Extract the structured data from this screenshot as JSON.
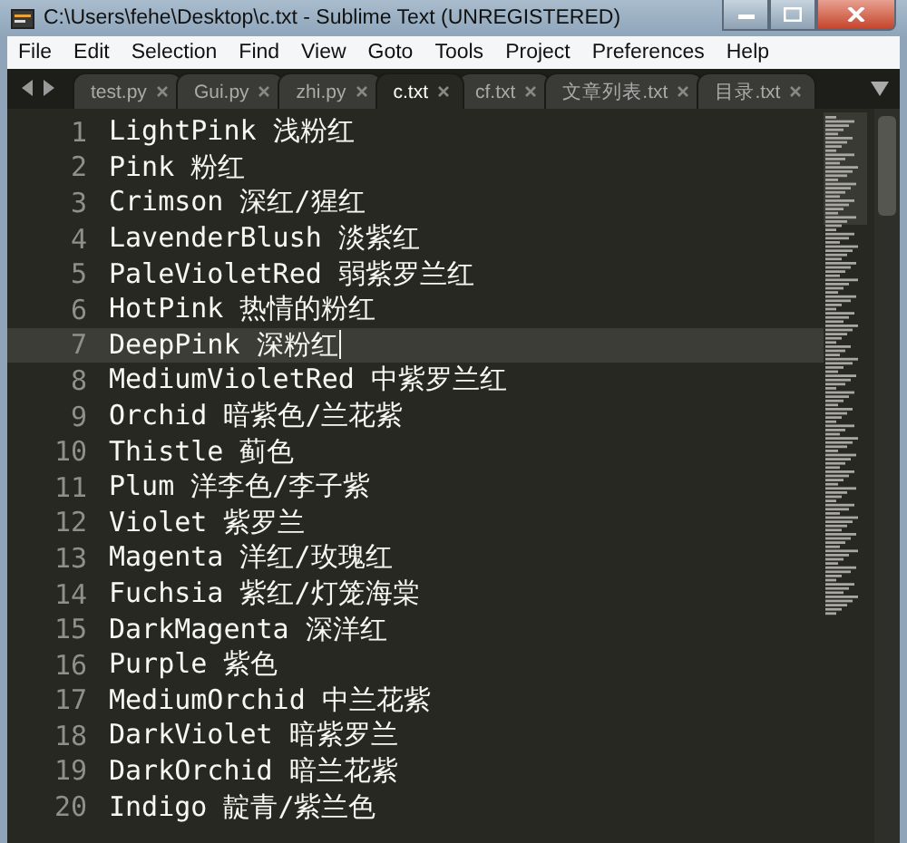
{
  "window": {
    "title": "C:\\Users\\fehe\\Desktop\\c.txt - Sublime Text (UNREGISTERED)"
  },
  "menu": [
    "File",
    "Edit",
    "Selection",
    "Find",
    "View",
    "Goto",
    "Tools",
    "Project",
    "Preferences",
    "Help"
  ],
  "tabs": [
    {
      "label": "test.py",
      "selected": false
    },
    {
      "label": "Gui.py",
      "selected": false
    },
    {
      "label": "zhi.py",
      "selected": false
    },
    {
      "label": "c.txt",
      "selected": true
    },
    {
      "label": "cf.txt",
      "selected": false
    },
    {
      "label": "文章列表.txt",
      "selected": false
    },
    {
      "label": "目录.txt",
      "selected": false
    }
  ],
  "lines": [
    {
      "number": "1",
      "text": "LightPink 浅粉红",
      "current": false
    },
    {
      "number": "2",
      "text": "Pink 粉红",
      "current": false
    },
    {
      "number": "3",
      "text": "Crimson 深红/猩红",
      "current": false
    },
    {
      "number": "4",
      "text": "LavenderBlush 淡紫红",
      "current": false
    },
    {
      "number": "5",
      "text": "PaleVioletRed 弱紫罗兰红",
      "current": false
    },
    {
      "number": "6",
      "text": "HotPink 热情的粉红",
      "current": false
    },
    {
      "number": "7",
      "text": "DeepPink 深粉红",
      "current": true
    },
    {
      "number": "8",
      "text": "MediumVioletRed 中紫罗兰红",
      "current": false
    },
    {
      "number": "9",
      "text": "Orchid 暗紫色/兰花紫",
      "current": false
    },
    {
      "number": "10",
      "text": "Thistle 蓟色",
      "current": false
    },
    {
      "number": "11",
      "text": "Plum 洋李色/李子紫",
      "current": false
    },
    {
      "number": "12",
      "text": "Violet 紫罗兰",
      "current": false
    },
    {
      "number": "13",
      "text": "Magenta 洋红/玫瑰红",
      "current": false
    },
    {
      "number": "14",
      "text": "Fuchsia 紫红/灯笼海棠",
      "current": false
    },
    {
      "number": "15",
      "text": "DarkMagenta 深洋红",
      "current": false
    },
    {
      "number": "16",
      "text": "Purple 紫色",
      "current": false
    },
    {
      "number": "17",
      "text": "MediumOrchid 中兰花紫",
      "current": false
    },
    {
      "number": "18",
      "text": "DarkViolet 暗紫罗兰",
      "current": false
    },
    {
      "number": "19",
      "text": "DarkOrchid 暗兰花紫",
      "current": false
    },
    {
      "number": "20",
      "text": "Indigo 靛青/紫兰色",
      "current": false
    }
  ]
}
